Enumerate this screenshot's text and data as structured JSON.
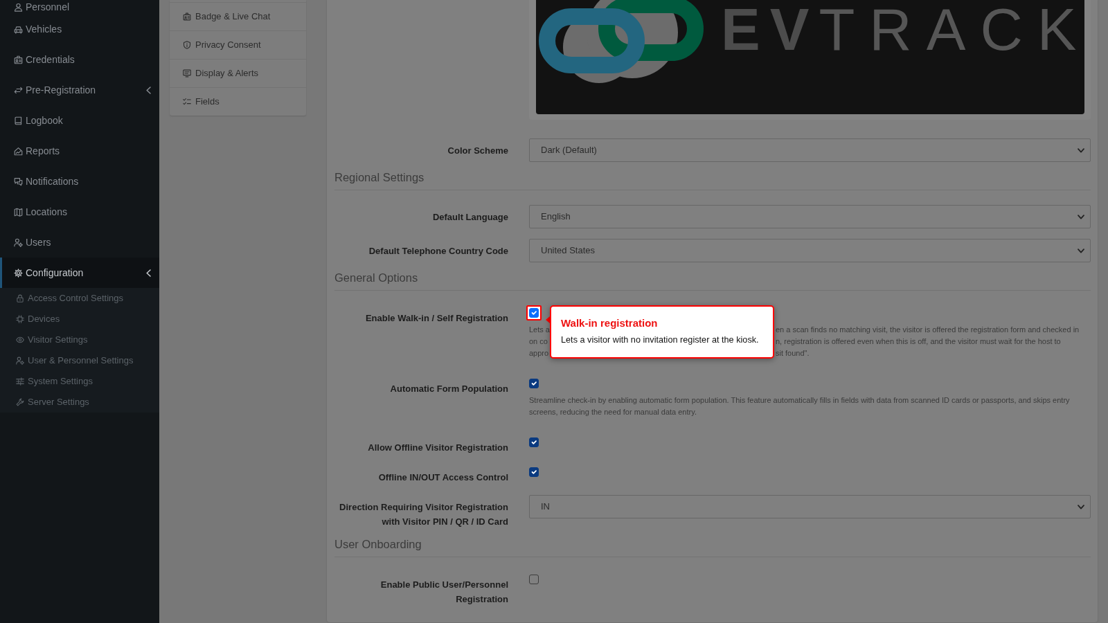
{
  "sidebar": {
    "items": [
      {
        "label": "Personnel",
        "expandable": false,
        "selected": false
      },
      {
        "label": "Vehicles",
        "expandable": false,
        "selected": false
      },
      {
        "label": "Credentials",
        "expandable": false,
        "selected": false
      },
      {
        "label": "Pre-Registration",
        "expandable": true,
        "selected": false
      },
      {
        "label": "Logbook",
        "expandable": false,
        "selected": false
      },
      {
        "label": "Reports",
        "expandable": false,
        "selected": false
      },
      {
        "label": "Notifications",
        "expandable": false,
        "selected": false
      },
      {
        "label": "Locations",
        "expandable": false,
        "selected": false
      },
      {
        "label": "Users",
        "expandable": false,
        "selected": false
      },
      {
        "label": "Configuration",
        "expandable": true,
        "selected": true,
        "children": [
          {
            "label": "Access Control Settings",
            "selected": false
          },
          {
            "label": "Devices",
            "selected": false
          },
          {
            "label": "Visitor Settings",
            "selected": false
          },
          {
            "label": "User & Personnel Settings",
            "selected": false
          },
          {
            "label": "System Settings",
            "selected": false
          },
          {
            "label": "Server Settings",
            "selected": false
          }
        ]
      }
    ]
  },
  "settings_nav": {
    "items": [
      {
        "label": "Badge & Live Chat",
        "selected": false
      },
      {
        "label": "Privacy Consent",
        "selected": false
      },
      {
        "label": "Display & Alerts",
        "selected": false
      },
      {
        "label": "Fields",
        "selected": false
      }
    ]
  },
  "form": {
    "logo_text": "**EV**TRACK",
    "rows": [
      {
        "kind": "select",
        "label": "Color Scheme",
        "value": "Dark (Default)"
      },
      {
        "kind": "section",
        "title": "Regional Settings"
      },
      {
        "kind": "select",
        "label": "Default Language",
        "value": "English"
      },
      {
        "kind": "select",
        "label": "Default Telephone Country Code",
        "value": "United States"
      },
      {
        "kind": "section",
        "title": "General Options"
      },
      {
        "kind": "checkbox",
        "label": "Enable Walk-in / Self Registration",
        "checked": true,
        "highlighted": true,
        "help_lines": [
          {
            "left": "Lets a",
            "right": "en a scan finds no matching visit, the visitor is offered the registration form and checked in"
          },
          {
            "left": "on co",
            "right": "n, registration is offered even when this is off, and the visitor must wait for the host to"
          },
          {
            "left": "appro",
            "right": "sit found\"."
          }
        ],
        "tooltip": {
          "title": "Walk-in registration",
          "text": "Lets a visitor with no invitation register at the kiosk."
        }
      },
      {
        "kind": "checkbox",
        "label": "Automatic Form Population",
        "checked": true,
        "highlighted": false,
        "help": "Streamline check-in by enabling automatic form population. This feature automatically fills in fields with data from scanned ID cards or passports, and skips entry screens, reducing the need for manual data entry."
      },
      {
        "kind": "checkbox",
        "label": "Allow Offline Visitor Registration",
        "checked": true,
        "highlighted": false
      },
      {
        "kind": "checkbox",
        "label": "Offline IN/OUT Access Control",
        "checked": true,
        "highlighted": false
      },
      {
        "kind": "select",
        "label": "Direction Requiring Visitor Registration with Visitor PIN / QR / ID Card",
        "value": "IN"
      },
      {
        "kind": "section",
        "title": "User Onboarding"
      },
      {
        "kind": "checkbox",
        "label": "Enable Public User/Personnel Registration",
        "checked": false,
        "highlighted": false
      }
    ]
  }
}
